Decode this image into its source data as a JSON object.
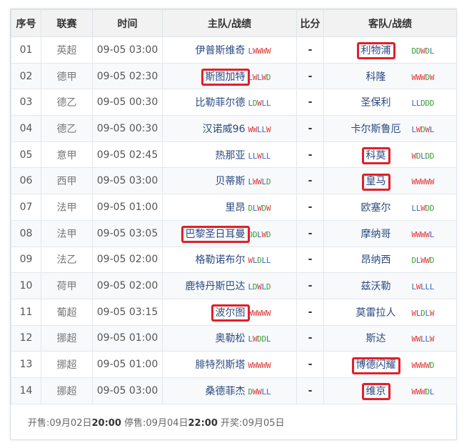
{
  "headers": {
    "idx": "序号",
    "league": "联赛",
    "time": "时间",
    "home": "主队/战绩",
    "score": "比分",
    "away": "客队/战绩"
  },
  "rows": [
    {
      "idx": "01",
      "league": "英超",
      "time": "09-05 03:00",
      "home": "伊普斯维奇",
      "home_rec": "LWWWW",
      "score": "-",
      "away": "利物浦",
      "away_rec": "DDWDL",
      "box_home": false,
      "box_away": true
    },
    {
      "idx": "02",
      "league": "德甲",
      "time": "09-05 02:30",
      "home": "斯图加特",
      "home_rec": "LWLWD",
      "score": "-",
      "away": "科隆",
      "away_rec": "WWWDW",
      "box_home": true,
      "box_away": false
    },
    {
      "idx": "03",
      "league": "德乙",
      "time": "09-05 00:30",
      "home": "比勒菲尔德",
      "home_rec": "LDWLL",
      "score": "-",
      "away": "圣保利",
      "away_rec": "LLDDD",
      "box_home": false,
      "box_away": false
    },
    {
      "idx": "04",
      "league": "德乙",
      "time": "09-05 00:30",
      "home": "汉诺威96",
      "home_rec": "WWLLW",
      "score": "-",
      "away": "卡尔斯鲁厄",
      "away_rec": "LWDWL",
      "box_home": false,
      "box_away": false
    },
    {
      "idx": "05",
      "league": "意甲",
      "time": "09-05 02:45",
      "home": "热那亚",
      "home_rec": "LLWLL",
      "score": "-",
      "away": "科莫",
      "away_rec": "WDLDD",
      "box_home": false,
      "box_away": true
    },
    {
      "idx": "06",
      "league": "西甲",
      "time": "09-05 03:00",
      "home": "贝蒂斯",
      "home_rec": "LWWLD",
      "score": "-",
      "away": "皇马",
      "away_rec": "WWWWW",
      "box_home": false,
      "box_away": true
    },
    {
      "idx": "07",
      "league": "法甲",
      "time": "09-05 01:00",
      "home": "里昂",
      "home_rec": "DLWDW",
      "score": "-",
      "away": "欧塞尔",
      "away_rec": "LLWDD",
      "box_home": false,
      "box_away": false
    },
    {
      "idx": "08",
      "league": "法甲",
      "time": "09-05 03:05",
      "home": "巴黎圣日耳曼",
      "home_rec": "DDLWD",
      "score": "-",
      "away": "摩纳哥",
      "away_rec": "WWWWL",
      "box_home": true,
      "box_away": false
    },
    {
      "idx": "09",
      "league": "法乙",
      "time": "09-05 02:00",
      "home": "格勒诺布尔",
      "home_rec": "WLDLL",
      "score": "-",
      "away": "昂纳西",
      "away_rec": "DLWWD",
      "box_home": false,
      "box_away": false
    },
    {
      "idx": "10",
      "league": "荷甲",
      "time": "09-05 02:00",
      "home": "鹿特丹斯巴达",
      "home_rec": "LDWLD",
      "score": "-",
      "away": "兹沃勒",
      "away_rec": "LWLLL",
      "box_home": false,
      "box_away": false
    },
    {
      "idx": "11",
      "league": "葡超",
      "time": "09-05 03:15",
      "home": "波尔图",
      "home_rec": "WWWWW",
      "score": "-",
      "away": "莫雷拉人",
      "away_rec": "WLDLW",
      "box_home": true,
      "box_away": false
    },
    {
      "idx": "12",
      "league": "挪超",
      "time": "09-05 01:00",
      "home": "奥勒松",
      "home_rec": "LWDDL",
      "score": "-",
      "away": "斯达",
      "away_rec": "WWLLW",
      "box_home": false,
      "box_away": false
    },
    {
      "idx": "13",
      "league": "挪超",
      "time": "09-05 01:00",
      "home": "腓特烈斯塔",
      "home_rec": "WWWWW",
      "score": "-",
      "away": "博德闪耀",
      "away_rec": "WWWWD",
      "box_home": false,
      "box_away": true
    },
    {
      "idx": "14",
      "league": "挪超",
      "time": "09-05 03:00",
      "home": "桑德菲杰",
      "home_rec": "DWWLL",
      "score": "-",
      "away": "维京",
      "away_rec": "WWWDL",
      "box_home": false,
      "box_away": true
    }
  ],
  "footer": {
    "sale_open_label": "开售:",
    "sale_open_date": "09月02日",
    "sale_open_time": "20:00",
    "sale_stop_label": "停售:",
    "sale_stop_date": "09月04日",
    "sale_stop_time": "22:00",
    "draw_label": "开奖:",
    "draw_date": "09月05日"
  },
  "colors": {
    "win": "#e03a3a",
    "draw": "#3a9a3a",
    "loss": "#3a66c8",
    "highlight_box": "#e0202a"
  }
}
